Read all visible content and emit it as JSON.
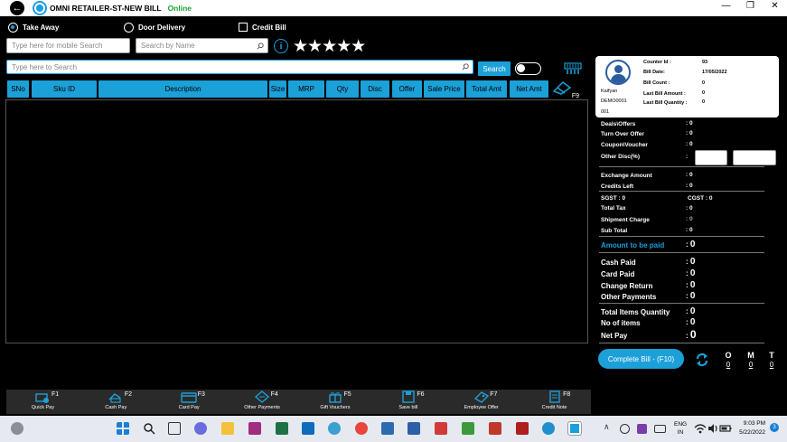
{
  "app": {
    "title": "OMNI RETAILER-ST-NEW BILL",
    "status": "Online"
  },
  "window_controls": {
    "minimize": "—",
    "maximize": "❐",
    "close": "✕"
  },
  "order_options": [
    {
      "label": "Take Away",
      "selected": true
    },
    {
      "label": "Door Delivery",
      "selected": false
    }
  ],
  "credit_bill": {
    "label": "Credit Bill",
    "checked": false
  },
  "inputs": {
    "mobile_search_placeholder": "Type here for mobile Search",
    "name_search_placeholder": "Search by Name",
    "main_search_placeholder": "Type here to Search"
  },
  "rating_stars": "★★★★★",
  "search_button": "Search",
  "grid_columns": [
    "SNo",
    "Sku ID",
    "Description",
    "Size",
    "MRP",
    "Qty",
    "Disc",
    "Offer",
    "Sale Price",
    "Total Amt",
    "Net Amt"
  ],
  "f9_label": "F9",
  "counter": {
    "user_name": "Kaifyan",
    "user_code": "DEMO0001",
    "user_sub": "001",
    "rows": [
      {
        "label": "Counter Id :",
        "value": "93"
      },
      {
        "label": "Bill Date:",
        "value": "17/05/2022"
      },
      {
        "label": "Bill Count :",
        "value": "0"
      },
      {
        "label": "Last Bill Amount :",
        "value": "0"
      },
      {
        "label": "Last Bill Quantity :",
        "value": "0"
      }
    ]
  },
  "summary": {
    "deals_offers": {
      "label": "Deals\\Offers",
      "value": "0"
    },
    "turn_over_offer": {
      "label": "Turn Over Offer",
      "value": "0"
    },
    "coupon_voucher": {
      "label": "Coupon\\Voucher",
      "value": "0"
    },
    "other_disc": {
      "label": "Other Disc(%)",
      "colon": ":"
    },
    "exchange_amount": {
      "label": "Exchange Amount",
      "value": "0"
    },
    "credits_left": {
      "label": "Credits Left",
      "value": "0"
    },
    "sgst": {
      "label": "SGST",
      "value": "0"
    },
    "cgst": {
      "label": "CGST",
      "value": "0"
    },
    "total_tax": {
      "label": "Total Tax",
      "value": "0"
    },
    "shipment_charge": {
      "label": "Shipment Charge",
      "value": "0"
    },
    "sub_total": {
      "label": "Sub Total",
      "value": "0"
    },
    "amount_to_be_paid": {
      "label": "Amount to be paid",
      "value": "0"
    },
    "cash_paid": {
      "label": "Cash Paid",
      "value": "0"
    },
    "card_paid": {
      "label": "Card Paid",
      "value": "0"
    },
    "change_return": {
      "label": "Change Return",
      "value": "0"
    },
    "other_payments": {
      "label": "Other Payments",
      "value": "0"
    },
    "total_items_quantity": {
      "label": "Total Items Quantity",
      "value": "0"
    },
    "no_of_items": {
      "label": "No of items",
      "value": "0"
    },
    "net_pay": {
      "label": "Net Pay",
      "value": "0"
    }
  },
  "complete_bill": "Complete Bill - (F10)",
  "omt": [
    {
      "label": "O",
      "value": "0"
    },
    {
      "label": "M",
      "value": "0"
    },
    {
      "label": "T",
      "value": "0"
    }
  ],
  "toolbar": [
    {
      "key": "F1",
      "label": "Quick Pay",
      "icon": "quick-pay-icon"
    },
    {
      "key": "F2",
      "label": "Cash Pay",
      "icon": "cash-pay-icon"
    },
    {
      "key": "F3",
      "label": "Card Pay",
      "icon": "card-pay-icon"
    },
    {
      "key": "F4",
      "label": "Other Payments",
      "icon": "other-payments-icon"
    },
    {
      "key": "F5",
      "label": "Gift Vouchers",
      "icon": "gift-voucher-icon"
    },
    {
      "key": "F6",
      "label": "Save bill",
      "icon": "save-icon"
    },
    {
      "key": "F7",
      "label": "Employee Offer",
      "icon": "employee-offer-icon"
    },
    {
      "key": "F8",
      "label": "Credit Note",
      "icon": "credit-note-icon"
    }
  ],
  "taskbar": {
    "lang": "ENG",
    "region": "IN",
    "time": "9:03 PM",
    "date": "5/22/2022",
    "notification_count": "3"
  },
  "colors": {
    "accent": "#1ca0d8",
    "online": "#1aa333",
    "background": "#000000"
  }
}
